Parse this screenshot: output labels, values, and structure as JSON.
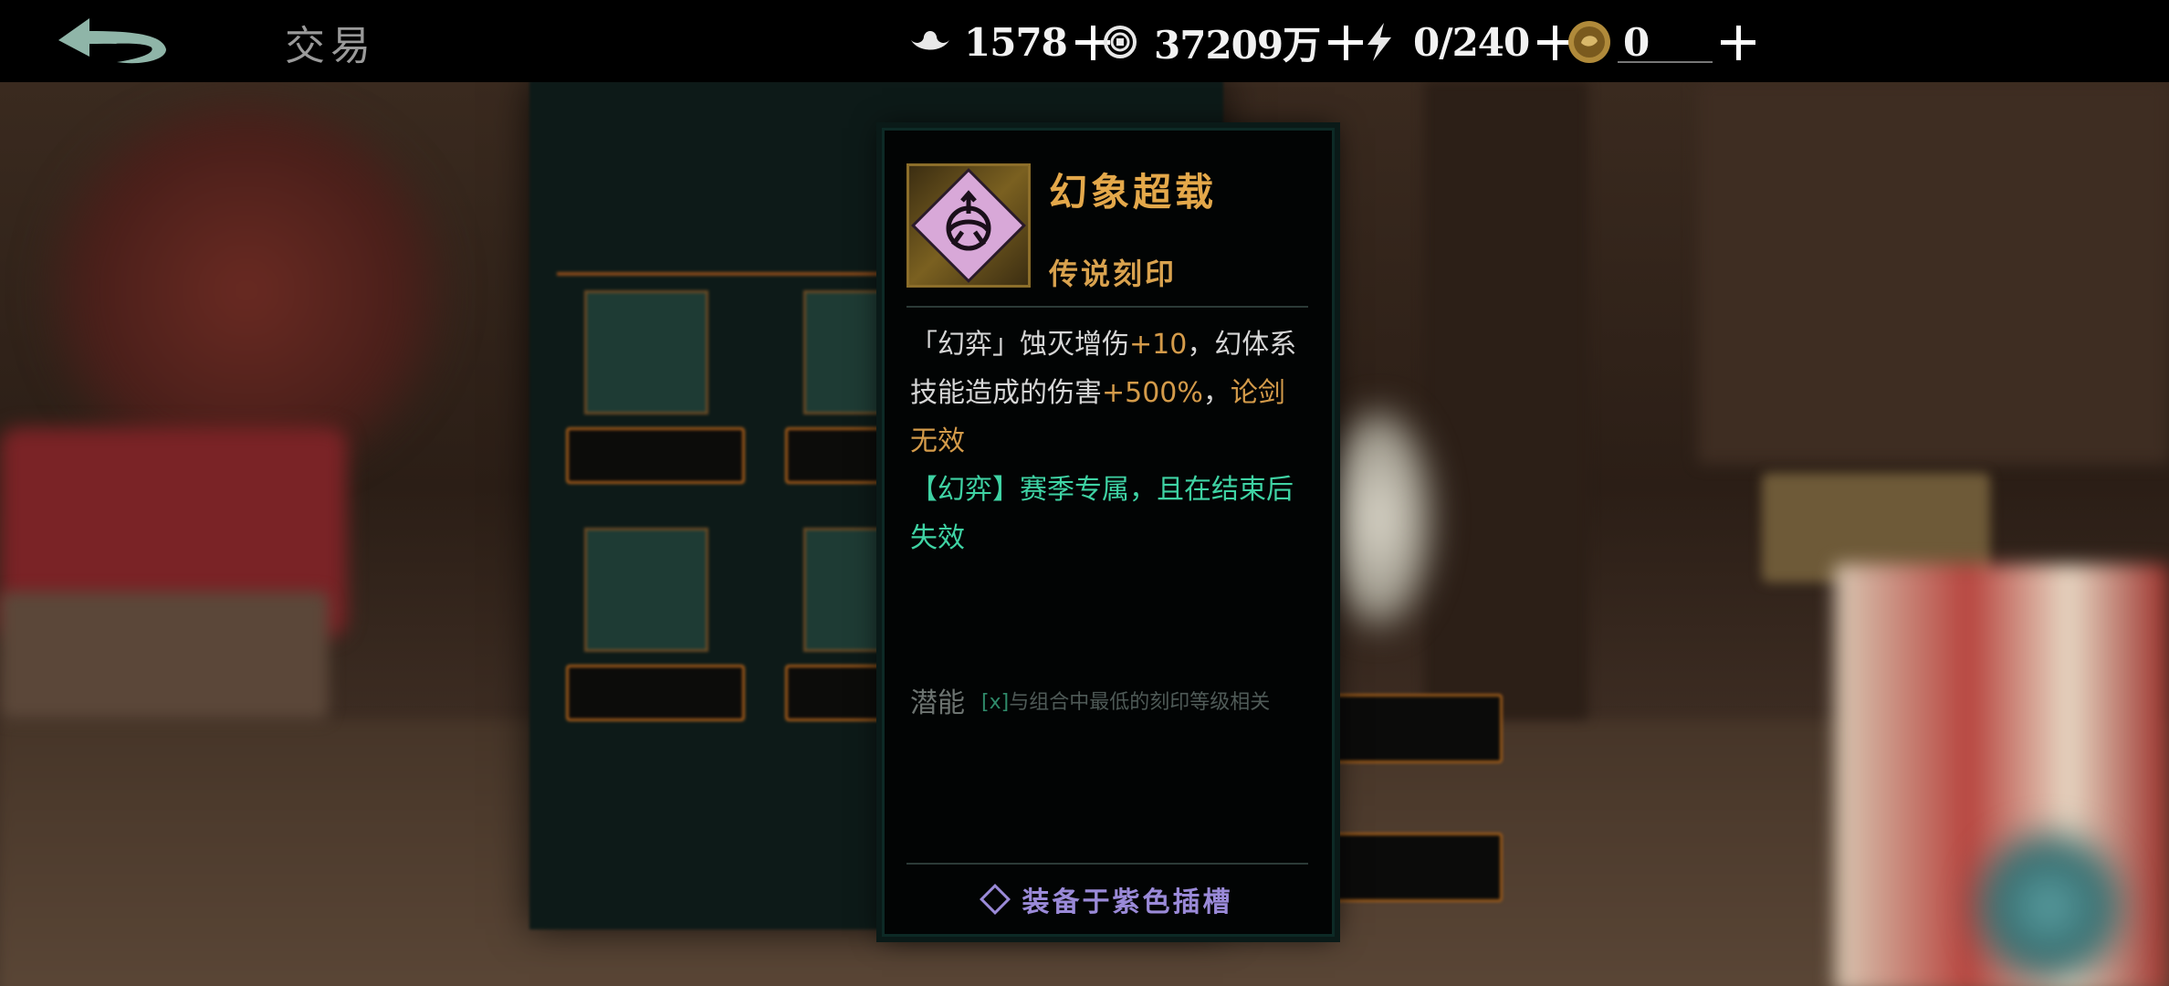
{
  "header": {
    "title": "交易",
    "back_icon": "back-arrow-icon"
  },
  "resources": [
    {
      "name": "silver-ingot",
      "icon": "silver-ingot-icon",
      "value": "1578"
    },
    {
      "name": "coins",
      "icon": "coin-icon",
      "value": "37209万"
    },
    {
      "name": "stamina",
      "icon": "lightning-icon",
      "value": "0/240"
    },
    {
      "name": "gold-token",
      "icon": "gold-token-icon",
      "value": "0"
    }
  ],
  "tooltip": {
    "item_name": "幻象超载",
    "item_type": "传说刻印",
    "icon": "purple-sigil-icon",
    "desc": {
      "p1": "「幻弈」蚀灭增伤",
      "p1_value": "+10",
      "p1_tail": "，幻体系技能造成的伤害",
      "p2_value": "+500%",
      "p2_sep": "，",
      "p2_orange": "论剑无效",
      "p3_green": "【幻弈】赛季专属，且在结束后失效"
    },
    "potential_label": "潜能",
    "potential_marker": "[x]",
    "potential_text": "与组合中最低的刻印等级相关",
    "equip_text": "装备于紫色插槽"
  },
  "colors": {
    "gold": "#e4a84a",
    "orange": "#d49b4a",
    "green": "#3fd3a4",
    "purple": "#9a8ad8"
  }
}
